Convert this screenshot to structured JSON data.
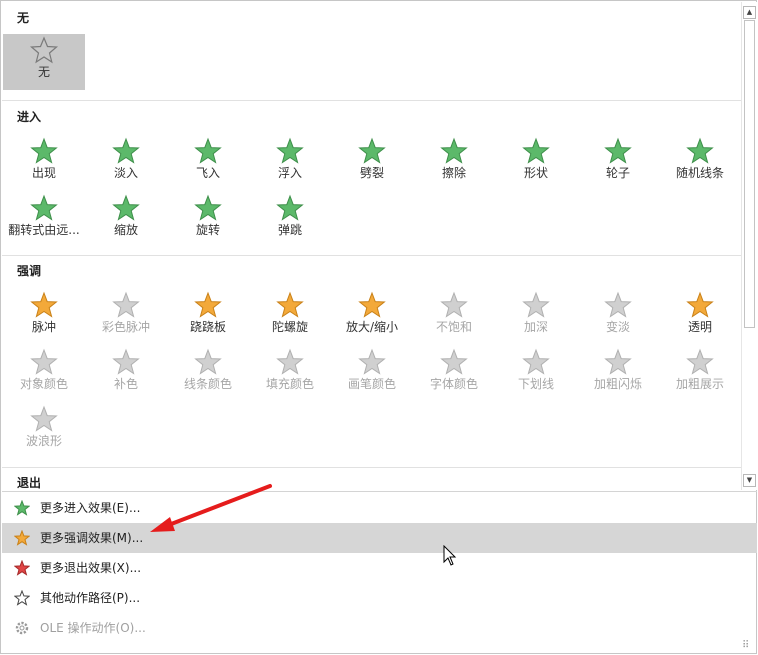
{
  "sections": {
    "none": {
      "title": "无"
    },
    "entrance": {
      "title": "进入"
    },
    "emphasis": {
      "title": "强调"
    },
    "exit": {
      "title": "退出"
    }
  },
  "none_tile": {
    "label": "无",
    "icon": "star-outline-icon"
  },
  "entrance_effects": [
    "出现",
    "淡入",
    "飞入",
    "浮入",
    "劈裂",
    "擦除",
    "形状",
    "轮子",
    "随机线条",
    "翻转式由远...",
    "缩放",
    "旋转",
    "弹跳"
  ],
  "emphasis_effects": [
    "脉冲",
    "彩色脉冲",
    "跷跷板",
    "陀螺旋",
    "放大/缩小",
    "不饱和",
    "加深",
    "变淡",
    "透明",
    "对象颜色",
    "补色",
    "线条颜色",
    "填充颜色",
    "画笔颜色",
    "字体颜色",
    "下划线",
    "加粗闪烁",
    "加粗展示",
    "波浪形"
  ],
  "emphasis_disabled": [
    false,
    true,
    false,
    false,
    false,
    true,
    true,
    true,
    false,
    true,
    true,
    true,
    true,
    true,
    true,
    true,
    true,
    true,
    true
  ],
  "menu": [
    {
      "label": "更多进入效果(E)...",
      "icon": "green-star-icon",
      "highlighted": false,
      "disabled": false
    },
    {
      "label": "更多强调效果(M)...",
      "icon": "orange-star-icon",
      "highlighted": true,
      "disabled": false
    },
    {
      "label": "更多退出效果(X)...",
      "icon": "red-star-icon",
      "highlighted": false,
      "disabled": false
    },
    {
      "label": "其他动作路径(P)...",
      "icon": "path-star-icon",
      "highlighted": false,
      "disabled": false
    },
    {
      "label": "OLE 操作动作(O)...",
      "icon": "gear-icon",
      "highlighted": false,
      "disabled": true
    }
  ],
  "colors": {
    "entrance": "#5cb96a",
    "emphasis": "#f3a93a",
    "exit": "#e04545",
    "disabled": "#c8c8c8",
    "highlight": "#d6d6d6",
    "arrow": "#e51c1c"
  }
}
